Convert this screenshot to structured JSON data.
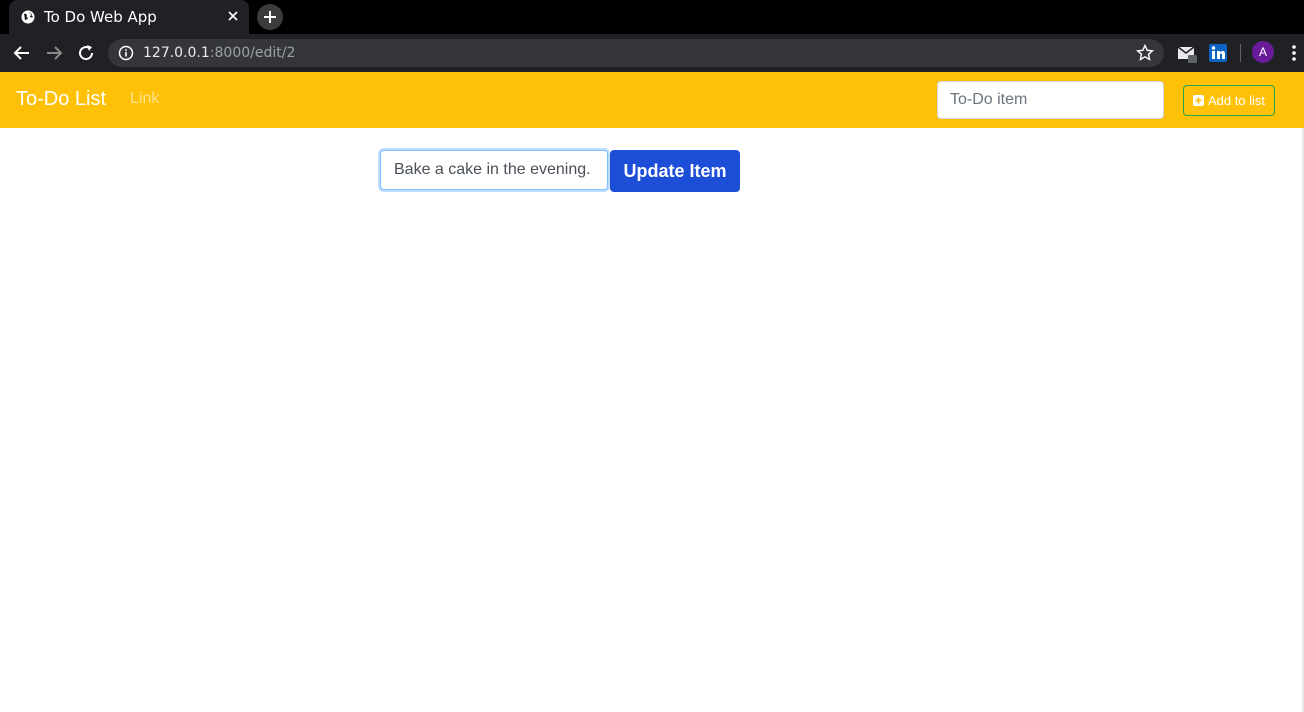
{
  "browser": {
    "tab_title": "To Do Web App",
    "url_host": "127.0.0.1",
    "url_path": ":8000/edit/2",
    "avatar_letter": "A",
    "icons": [
      "globe-icon",
      "close-icon",
      "plus-icon",
      "back-arrow-icon",
      "forward-arrow-icon",
      "reload-icon",
      "info-icon",
      "star-icon",
      "gmail-icon",
      "linkedin-icon",
      "kebab-menu-icon"
    ],
    "colors": {
      "tabbar": "#000000",
      "toolbar": "#202124",
      "omnibox": "#35363a",
      "avatar": "#6a1b9a"
    }
  },
  "navbar": {
    "brand": "To-Do List",
    "link": "Link",
    "input_placeholder": "To-Do item",
    "add_button_label": "Add to list",
    "colors": {
      "background": "#ffc107",
      "add_button_border": "#28a745"
    }
  },
  "main": {
    "edit_value": "Bake a cake in the evening.",
    "update_button_label": "Update Item",
    "colors": {
      "update_button": "#1d4ed8"
    }
  }
}
